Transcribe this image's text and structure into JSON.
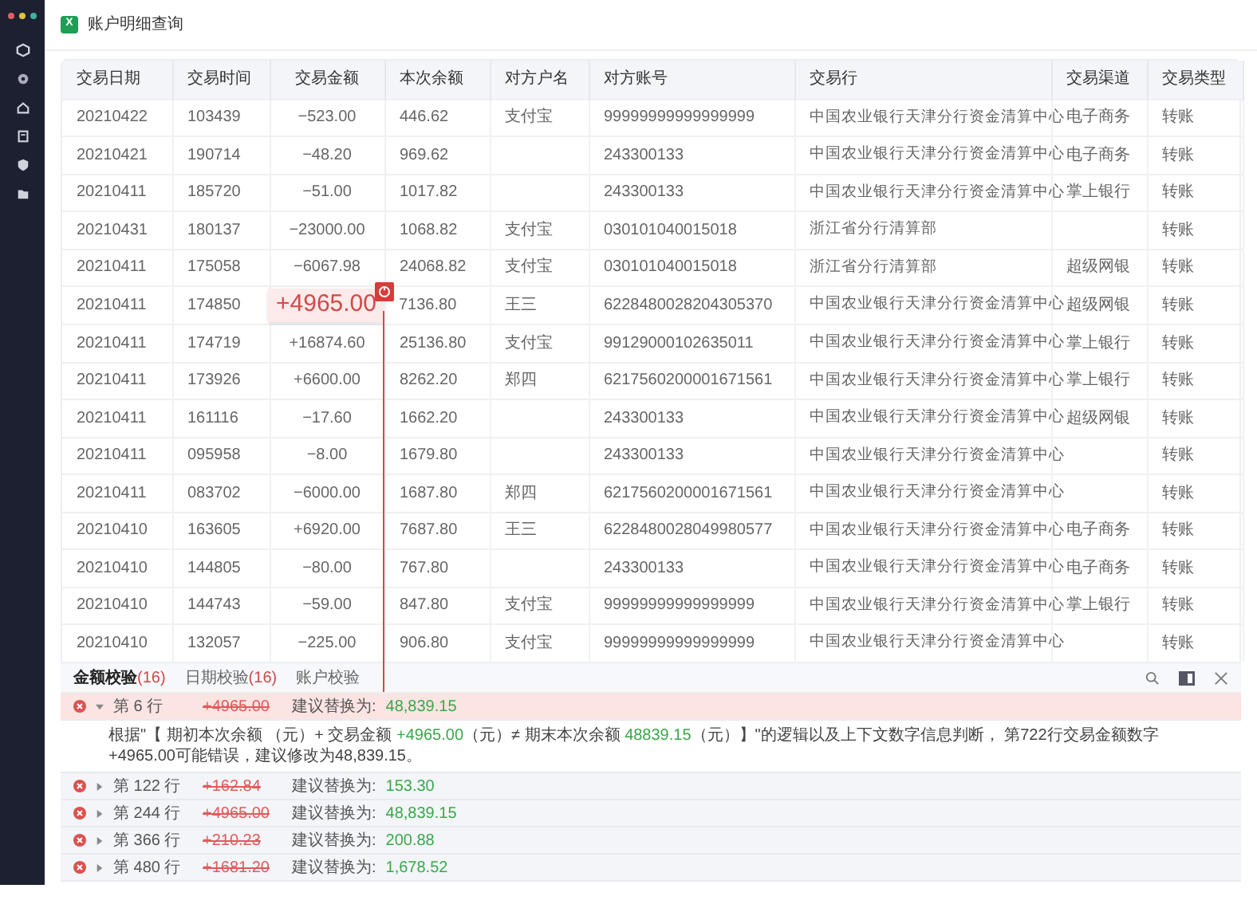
{
  "window": {
    "title": "账户明细查询",
    "app_icon_letter": "X"
  },
  "sidebar": {
    "items": [
      {
        "kind": "cube"
      },
      {
        "kind": "gear"
      },
      {
        "kind": "home"
      },
      {
        "kind": "doc"
      },
      {
        "kind": "shield"
      },
      {
        "kind": "folder"
      }
    ]
  },
  "table": {
    "columns": [
      "交易日期",
      "交易时间",
      "交易金额",
      "本次余额",
      "对方户名",
      "对方账号",
      "交易行",
      "交易渠道",
      "交易类型"
    ],
    "rows": [
      {
        "cells": [
          "20210422",
          "103439",
          "−523.00",
          "446.62",
          "支付宝",
          "99999999999999999",
          "中国农业银行天津分行资金清算中心",
          "电子商务",
          "转账"
        ],
        "flagged": false
      },
      {
        "cells": [
          "20210421",
          "190714",
          "−48.20",
          "969.62",
          "",
          "243300133",
          "中国农业银行天津分行资金清算中心",
          "电子商务",
          "转账"
        ],
        "flagged": false
      },
      {
        "cells": [
          "20210411",
          "185720",
          "−51.00",
          "1017.82",
          "",
          "243300133",
          "中国农业银行天津分行资金清算中心",
          "掌上银行",
          "转账"
        ],
        "flagged": false
      },
      {
        "cells": [
          "20210431",
          "180137",
          "−23000.00",
          "1068.82",
          "支付宝",
          "030101040015018",
          "浙江省分行清算部",
          "",
          "转账"
        ],
        "flagged": false
      },
      {
        "cells": [
          "20210411",
          "175058",
          "−6067.98",
          "24068.82",
          "支付宝",
          "030101040015018",
          "浙江省分行清算部",
          "超级网银",
          "转账"
        ],
        "flagged": false
      },
      {
        "cells": [
          "20210411",
          "174850",
          "+4965.00",
          "7136.80",
          "王三",
          "6228480028204305370",
          "中国农业银行天津分行资金清算中心",
          "超级网银",
          "转账"
        ],
        "flagged": true
      },
      {
        "cells": [
          "20210411",
          "174719",
          "+16874.60",
          "25136.80",
          "支付宝",
          "99129000102635011",
          "中国农业银行天津分行资金清算中心",
          "掌上银行",
          "转账"
        ],
        "flagged": false
      },
      {
        "cells": [
          "20210411",
          "173926",
          "+6600.00",
          "8262.20",
          "郑四",
          "6217560200001671561",
          "中国农业银行天津分行资金清算中心",
          "掌上银行",
          "转账"
        ],
        "flagged": false
      },
      {
        "cells": [
          "20210411",
          "161116",
          "−17.60",
          "1662.20",
          "",
          "243300133",
          "中国农业银行天津分行资金清算中心",
          "超级网银",
          "转账"
        ],
        "flagged": false
      },
      {
        "cells": [
          "20210411",
          "095958",
          "−8.00",
          "1679.80",
          "",
          "243300133",
          "中国农业银行天津分行资金清算中心",
          "",
          "转账"
        ],
        "flagged": false
      },
      {
        "cells": [
          "20210411",
          "083702",
          "−6000.00",
          "1687.80",
          "郑四",
          "6217560200001671561",
          "中国农业银行天津分行资金清算中心",
          "",
          "转账"
        ],
        "flagged": false
      },
      {
        "cells": [
          "20210410",
          "163605",
          "+6920.00",
          "7687.80",
          "王三",
          "6228480028049980577",
          "中国农业银行天津分行资金清算中心",
          "电子商务",
          "转账"
        ],
        "flagged": false
      },
      {
        "cells": [
          "20210410",
          "144805",
          "−80.00",
          "767.80",
          "",
          "243300133",
          "中国农业银行天津分行资金清算中心",
          "电子商务",
          "转账"
        ],
        "flagged": false
      },
      {
        "cells": [
          "20210410",
          "144743",
          "−59.00",
          "847.80",
          "支付宝",
          "99999999999999999",
          "中国农业银行天津分行资金清算中心",
          "掌上银行",
          "转账"
        ],
        "flagged": false
      },
      {
        "cells": [
          "20210410",
          "132057",
          "−225.00",
          "906.80",
          "支付宝",
          "99999999999999999",
          "中国农业银行天津分行资金清算中心",
          "",
          "转账"
        ],
        "flagged": false
      }
    ]
  },
  "check_panel": {
    "tabs": [
      {
        "label": "金额校验",
        "count": "(16)",
        "selected": true
      },
      {
        "label": "日期校验",
        "count": "(16)",
        "selected": false
      },
      {
        "label": "账户校验",
        "selected": false
      }
    ],
    "issues": [
      {
        "line": "第 6 行",
        "wrong": "+4965.00",
        "suggest_label": "建议替换为:",
        "suggestion": "48,839.15",
        "expanded": true,
        "explanation": [
          {
            "text": "根据\"【 期初本次余额 （元）+ 交易金额 ",
            "kind": "plain"
          },
          {
            "text": "+4965.00",
            "kind": "value"
          },
          {
            "text": "（元）≠ 期末本次余额 ",
            "kind": "plain"
          },
          {
            "text": "48839.15",
            "kind": "value"
          },
          {
            "text": "（元）】\"的逻辑以及上下文数字信息判断， 第722行交易金额数字 +4965.00可能错误，建议修改为48,839.15。",
            "kind": "plain"
          }
        ]
      },
      {
        "line": "第 122 行",
        "wrong": "+162.84",
        "suggest_label": "建议替换为:",
        "suggestion": "153.30",
        "expanded": false
      },
      {
        "line": "第 244 行",
        "wrong": "+4965.00",
        "suggest_label": "建议替换为:",
        "suggestion": "48,839.15",
        "expanded": false
      },
      {
        "line": "第 366 行",
        "wrong": "+210.23",
        "suggest_label": "建议替换为:",
        "suggestion": "200.88",
        "expanded": false
      },
      {
        "line": "第 480 行",
        "wrong": "+1681.20",
        "suggest_label": "建议替换为:",
        "suggestion": "1,678.52",
        "expanded": false
      }
    ]
  }
}
